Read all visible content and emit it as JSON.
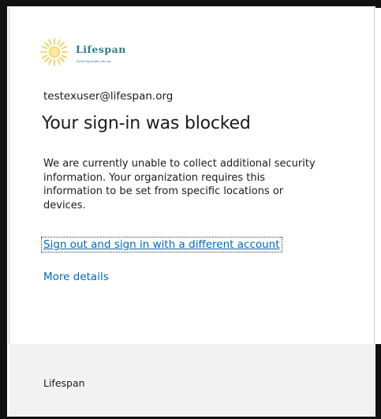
{
  "brand": {
    "name": "Lifespan",
    "tagline": "Delivering health with care",
    "accent_color": "#2d7c86",
    "sun_color": "#f2c94c"
  },
  "signin": {
    "email": "testexuser@lifespan.org",
    "title": "Your sign-in was blocked",
    "description_lines": [
      "We are currently unable to collect additional security",
      "information. Your organization requires this",
      "information to be set from specific locations or",
      "devices."
    ],
    "signout_link": "Sign out and sign in with a different account",
    "more_details_link": "More details",
    "link_color": "#0067b8"
  },
  "footer": {
    "text": "Lifespan"
  }
}
